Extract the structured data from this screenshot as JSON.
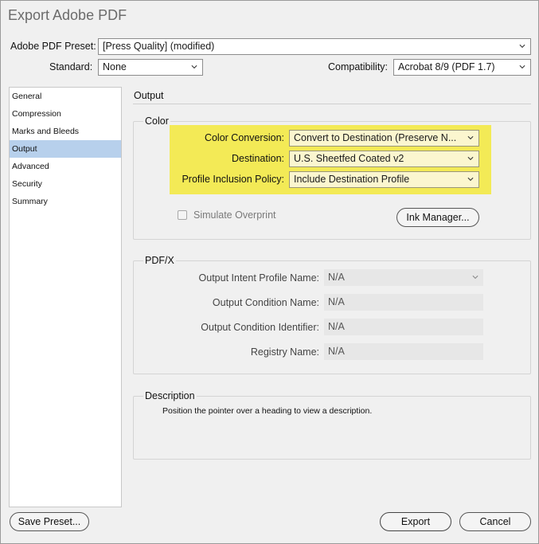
{
  "window": {
    "title": "Export Adobe PDF"
  },
  "top": {
    "preset_label": "Adobe PDF Preset:",
    "preset_value": "[Press Quality] (modified)",
    "standard_label": "Standard:",
    "standard_value": "None",
    "compat_label": "Compatibility:",
    "compat_value": "Acrobat 8/9 (PDF 1.7)"
  },
  "sidebar": {
    "items": [
      {
        "label": "General"
      },
      {
        "label": "Compression"
      },
      {
        "label": "Marks and Bleeds"
      },
      {
        "label": "Output"
      },
      {
        "label": "Advanced"
      },
      {
        "label": "Security"
      },
      {
        "label": "Summary"
      }
    ],
    "selected_index": 3
  },
  "output": {
    "heading": "Output",
    "color": {
      "label": "Color",
      "conversion_label": "Color Conversion:",
      "conversion_value": "Convert to Destination (Preserve N...",
      "destination_label": "Destination:",
      "destination_value": "U.S. Sheetfed Coated v2",
      "policy_label": "Profile Inclusion Policy:",
      "policy_value": "Include Destination Profile",
      "simulate_label": "Simulate Overprint",
      "ink_manager": "Ink Manager..."
    },
    "pdfx": {
      "label": "PDF/X",
      "intent_label": "Output Intent Profile Name:",
      "intent_value": "N/A",
      "condition_name_label": "Output Condition Name:",
      "condition_name_value": "N/A",
      "condition_id_label": "Output Condition Identifier:",
      "condition_id_value": "N/A",
      "registry_label": "Registry Name:",
      "registry_value": "N/A"
    },
    "description": {
      "label": "Description",
      "text": "Position the pointer over a heading to view a description."
    }
  },
  "buttons": {
    "save_preset": "Save Preset...",
    "export": "Export",
    "cancel": "Cancel"
  },
  "colors": {
    "highlight": "#f3ea56",
    "sidebar_selected": "#b7d0ec"
  }
}
